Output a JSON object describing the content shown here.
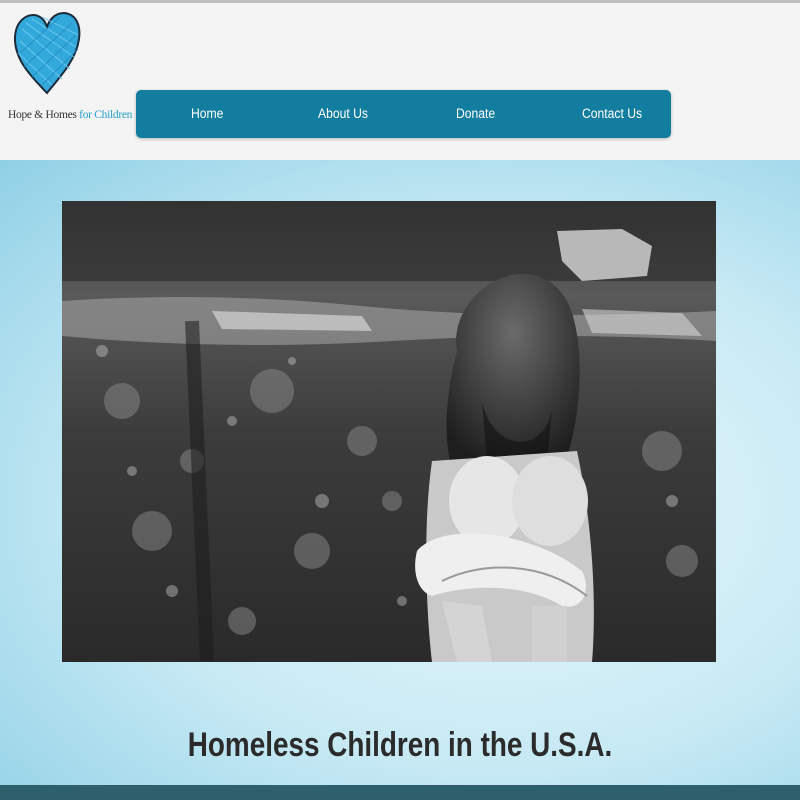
{
  "logo": {
    "icon": "blue-heart-icon",
    "text_part1": "Hope & Homes",
    "text_part2": "for Children"
  },
  "nav": {
    "items": [
      {
        "label": "Home"
      },
      {
        "label": "About Us"
      },
      {
        "label": "Donate"
      },
      {
        "label": "Contact Us"
      }
    ]
  },
  "hero": {
    "image": "black-and-white photo of a child sitting against a stone wall"
  },
  "headline": "Homeless Children in the U.S.A.",
  "colors": {
    "nav_bg": "#137d9f",
    "brand_blue": "#2a9fc9",
    "heart_blue": "#33a8db",
    "footer": "#2d5f6d"
  }
}
